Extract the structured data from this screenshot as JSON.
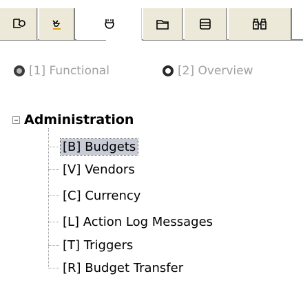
{
  "tabs": [
    {
      "icon": "portal-icon",
      "active": false
    },
    {
      "icon": "pin-icon",
      "active": false
    },
    {
      "icon": "tag-icon",
      "active": true
    },
    {
      "icon": "folder-icon",
      "active": false
    },
    {
      "icon": "list-icon",
      "active": false
    },
    {
      "icon": "binoculars-icon",
      "active": false
    }
  ],
  "view_mode": {
    "options": [
      {
        "label": "[1] Functional",
        "selected": true
      },
      {
        "label": "[2] Overview",
        "selected": false
      }
    ]
  },
  "tree": {
    "root_label": "Administration",
    "expanded": true,
    "items": [
      {
        "label": "[B] Budgets",
        "selected": true
      },
      {
        "label": "[V] Vendors",
        "selected": false
      },
      {
        "label": "[C] Currency",
        "selected": false
      },
      {
        "label": "[L] Action Log Messages",
        "selected": false
      },
      {
        "label": "[T] Triggers",
        "selected": false
      },
      {
        "label": "[R] Budget Transfer",
        "selected": false
      }
    ]
  },
  "colors": {
    "tab_face": "#ece9d8",
    "tab_border": "#808080",
    "radio_label": "#a0a0a0",
    "selection": "#c7cbd6"
  }
}
